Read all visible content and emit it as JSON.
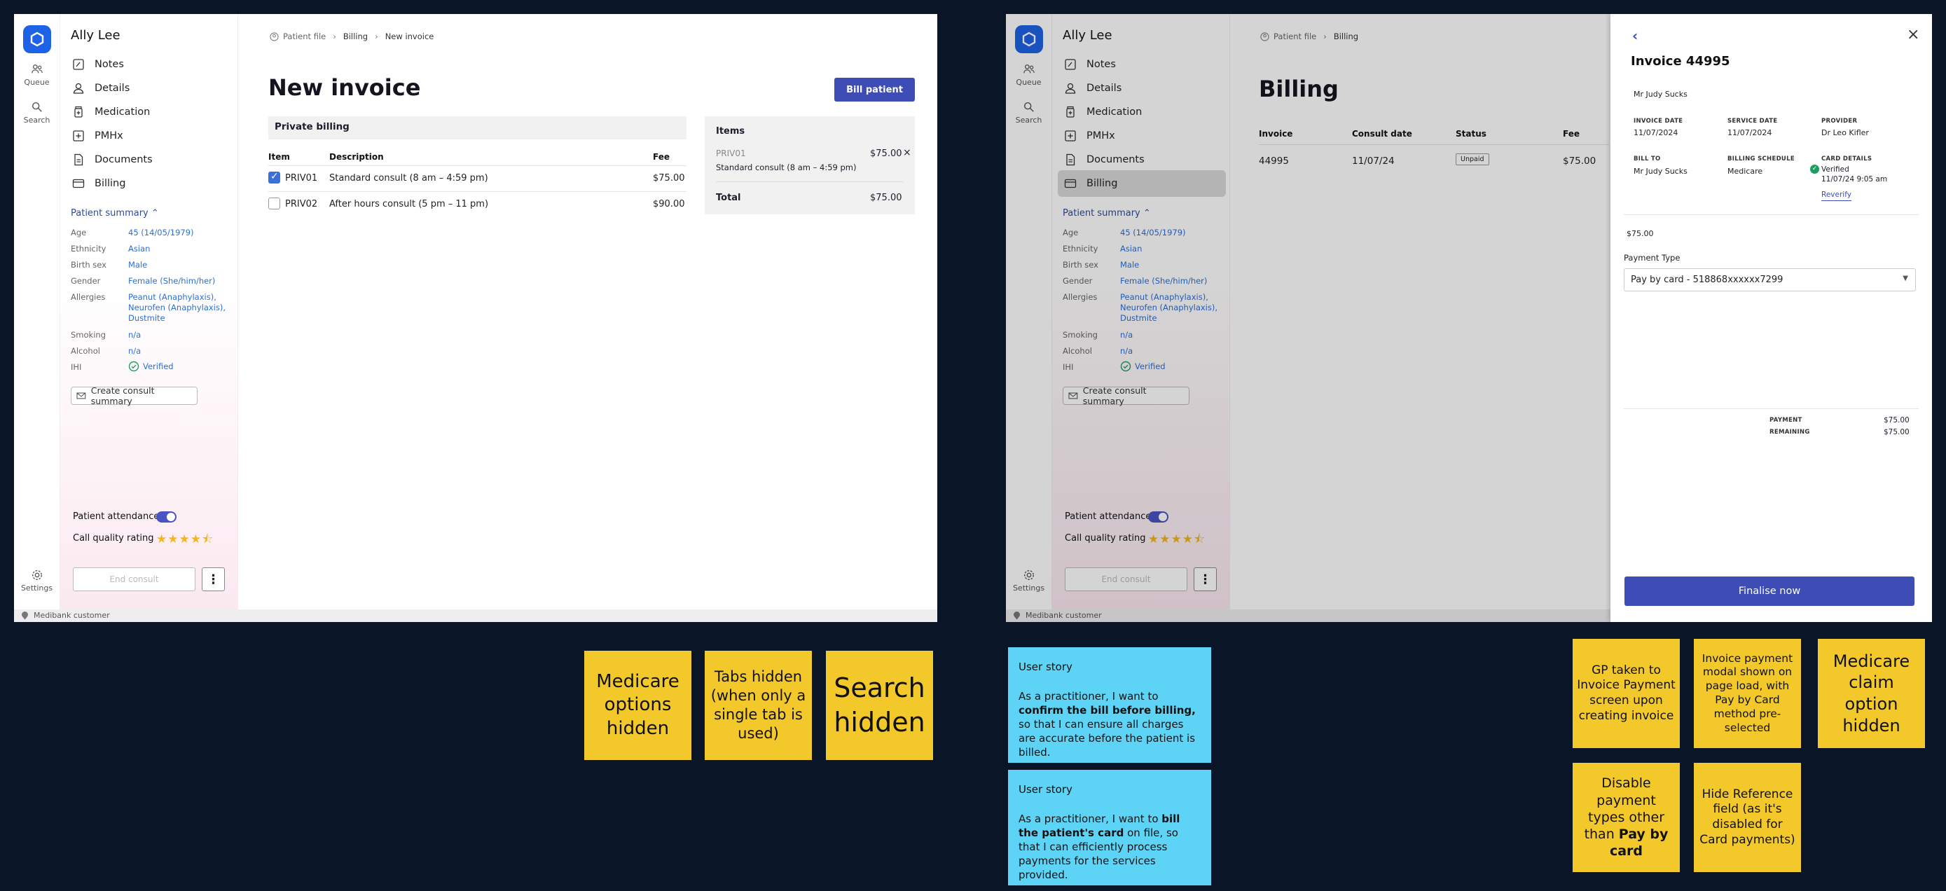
{
  "shared": {
    "rail": {
      "queue": "Queue",
      "search": "Search",
      "settings": "Settings"
    },
    "patient_name": "Ally Lee",
    "nav": [
      "Notes",
      "Details",
      "Medication",
      "PMHx",
      "Documents",
      "Billing"
    ],
    "summary": {
      "title": "Patient summary",
      "rows": [
        {
          "label": "Age",
          "value": "45 (14/05/1979)"
        },
        {
          "label": "Ethnicity",
          "value": "Asian"
        },
        {
          "label": "Birth sex",
          "value": "Male"
        },
        {
          "label": "Gender",
          "value": "Female (She/him/her)"
        },
        {
          "label": "Allergies",
          "value": "Peanut (Anaphylaxis), Neurofen (Anaphylaxis), Dustmite"
        },
        {
          "label": "Smoking",
          "value": "n/a"
        },
        {
          "label": "Alcohol",
          "value": "n/a"
        },
        {
          "label": "IHI",
          "value": "Verified"
        }
      ]
    },
    "create_consult_summary": "Create consult summary",
    "patient_attendance": "Patient attendance",
    "call_quality": "Call quality rating",
    "end_consult": "End consult",
    "footer": "Medibank customer"
  },
  "screen1": {
    "crumbs": [
      "Patient file",
      "Billing",
      "New invoice"
    ],
    "title": "New invoice",
    "bill_patient": "Bill patient",
    "section": "Private billing",
    "cols": [
      "Item",
      "Description",
      "Fee"
    ],
    "rows": [
      {
        "item": "PRIV01",
        "desc": "Standard consult (8 am – 4:59 pm)",
        "fee": "$75.00",
        "checked": true
      },
      {
        "item": "PRIV02",
        "desc": "After hours consult (5 pm – 11 pm)",
        "fee": "$90.00",
        "checked": false
      }
    ],
    "items_panel": {
      "title": "Items",
      "code": "PRIV01",
      "price": "$75.00",
      "desc": "Standard consult (8 am – 4:59 pm)",
      "total_label": "Total",
      "total": "$75.00"
    }
  },
  "screen2": {
    "crumbs": [
      "Patient file",
      "Billing"
    ],
    "title": "Billing",
    "cols": [
      "Invoice",
      "Consult date",
      "Status",
      "Fee"
    ],
    "row": {
      "invoice": "44995",
      "date": "11/07/24",
      "status": "Unpaid",
      "fee": "$75.00"
    },
    "modal": {
      "title": "Invoice 44995",
      "patient": "Mr Judy Sucks",
      "invoice_date_label": "INVOICE DATE",
      "invoice_date": "11/07/2024",
      "service_date_label": "SERVICE DATE",
      "service_date": "11/07/2024",
      "provider_label": "PROVIDER",
      "provider": "Dr Leo Kifler",
      "bill_to_label": "BILL TO",
      "bill_to": "Mr Judy Sucks",
      "schedule_label": "BILLING SCHEDULE",
      "schedule": "Medicare",
      "card_label": "CARD DETAILS",
      "card_status": "Verified",
      "card_time": "11/07/24 9:05 am",
      "reverify": "Reverify",
      "amount": "$75.00",
      "payment_type_label": "Payment Type",
      "payment_type": "Pay by card - 518868xxxxxx7299",
      "payment_label": "PAYMENT",
      "payment": "$75.00",
      "remaining_label": "REMAINING",
      "remaining": "$75.00",
      "finalise": "Finalise now"
    }
  },
  "notes": {
    "medicare": "Medicare options hidden",
    "tabs": "Tabs hidden (when only a single tab is used)",
    "search": "Search hidden",
    "story1_head": "User story",
    "story1_pre": "As a practitioner, I want to ",
    "story1_bold": "confirm the bill before billing,",
    "story1_post": " so that I can ensure all charges are accurate before the patient is billed.",
    "story2_head": "User story",
    "story2_pre": "As a practitioner, I want to ",
    "story2_bold": "bill the patient's card",
    "story2_post": " on file, so that I can efficiently process payments for the services provided.",
    "gp": "GP taken to Invoice Payment screen upon creating invoice",
    "modal_note": "Invoice payment modal shown  on page load, with Pay by Card method pre-selected",
    "claim": "Medicare claim option hidden",
    "disable_pre": "Disable payment types other than ",
    "disable_bold": "Pay by card",
    "hide_ref": "Hide Reference field (as it's disabled for Card payments)"
  },
  "colors": {
    "primary": "#3e4db5",
    "logo": "#1e63e6",
    "sticky_yellow": "#f3c82b",
    "sticky_blue": "#5dd4f5",
    "background": "#0a1628"
  }
}
